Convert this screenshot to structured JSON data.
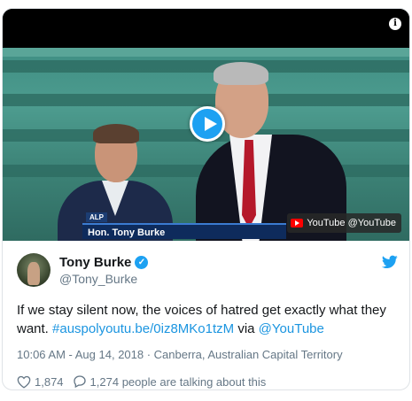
{
  "video": {
    "lower_third_party": "ALP",
    "lower_third_name": "Hon. Tony Burke",
    "youtube_badge": "YouTube @YouTube",
    "info_icon": "info-icon",
    "play_icon": "play-icon"
  },
  "author": {
    "display_name": "Tony Burke",
    "handle": "@Tony_Burke",
    "verified": true
  },
  "tweet": {
    "text": "If we stay silent now, the voices of hatred get exactly what they want. ",
    "link": "#auspolyoutu.be/0iz8MKo1tzM",
    "via_word": " via ",
    "via_handle": "@YouTube"
  },
  "meta": {
    "time": "10:06 AM - Aug 14, 2018",
    "separator": " · ",
    "location": "Canberra, Australian Capital Territory"
  },
  "actions": {
    "likes": "1,874",
    "talking": "1,274 people are talking about this"
  },
  "colors": {
    "accent": "#1da1f2",
    "link": "#1b95e0",
    "secondary_text": "#657786"
  }
}
